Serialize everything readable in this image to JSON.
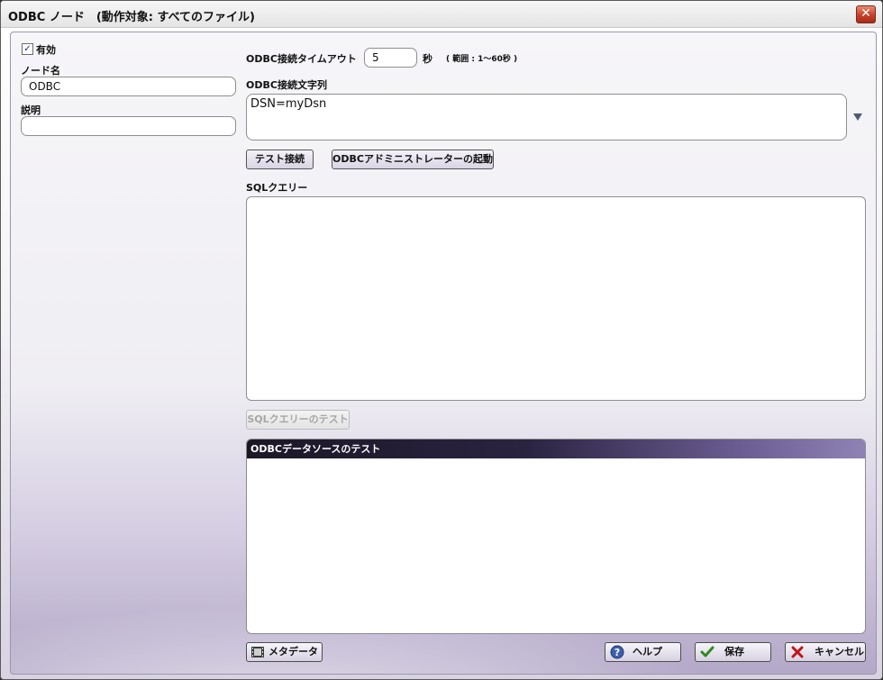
{
  "window": {
    "title": "ODBC ノード　(動作対象: すべてのファイル)",
    "close_glyph": "✕"
  },
  "left": {
    "enabled_label": "有効",
    "enabled_checked": true,
    "node_name_label": "ノード名",
    "node_name_value": "ODBC",
    "description_label": "説明",
    "description_value": ""
  },
  "odbc": {
    "timeout_label": "ODBC接続タイムアウト",
    "timeout_value": "5",
    "timeout_unit": "秒",
    "timeout_range": "( 範囲 : 1～60秒 )",
    "conn_string_label": "ODBC接続文字列",
    "conn_string_value": "DSN=myDsn",
    "test_connection_label": "テスト接続",
    "launch_admin_label": "ODBCアドミニストレーターの起動",
    "sql_query_label": "SQLクエリー",
    "sql_query_value": "",
    "test_sql_label": "SQLクエリーのテスト",
    "datasource_test_header": "ODBCデータソースのテスト"
  },
  "footer": {
    "metadata_label": "メタデータ",
    "help_label": "ヘルプ",
    "save_label": "保存",
    "cancel_label": "キャンセル"
  },
  "colors": {
    "accent_header": "#2a2340",
    "close_button": "#c5412a"
  },
  "icons": {
    "close": "close-icon",
    "metadata": "film-icon",
    "help": "help-icon",
    "save": "checkmark-icon",
    "cancel": "x-icon",
    "dropdown": "chevron-down-icon"
  }
}
